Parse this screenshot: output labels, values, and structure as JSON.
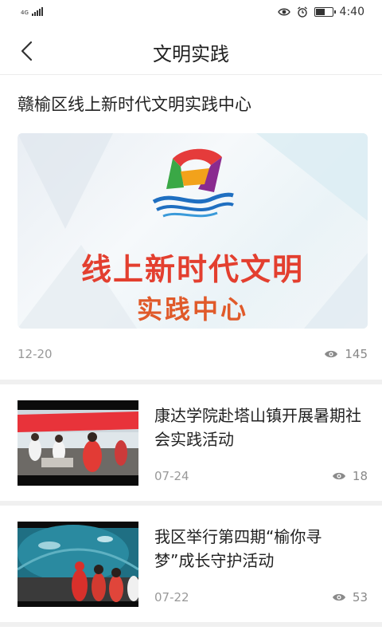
{
  "status": {
    "network": "4G",
    "time": "4:40",
    "battery_level": 0.55
  },
  "header": {
    "title": "文明实践",
    "back_icon": "chevron-left-icon"
  },
  "featured": {
    "title": "赣榆区线上新时代文明实践中心",
    "banner_line1": "线上新时代文明",
    "banner_line2": "实践中心",
    "date": "12-20",
    "views": "145"
  },
  "news": [
    {
      "title": "康达学院赴塔山镇开展暑期社会实践活动",
      "date": "07-24",
      "views": "18"
    },
    {
      "title": "我区举行第四期“榆你寻梦”成长守护活动",
      "date": "07-22",
      "views": "53"
    }
  ],
  "colors": {
    "accent_red": "#e33f2f",
    "accent_orange": "#e05a2a",
    "meta_gray": "#999999",
    "separator": "#f0f0f0"
  }
}
